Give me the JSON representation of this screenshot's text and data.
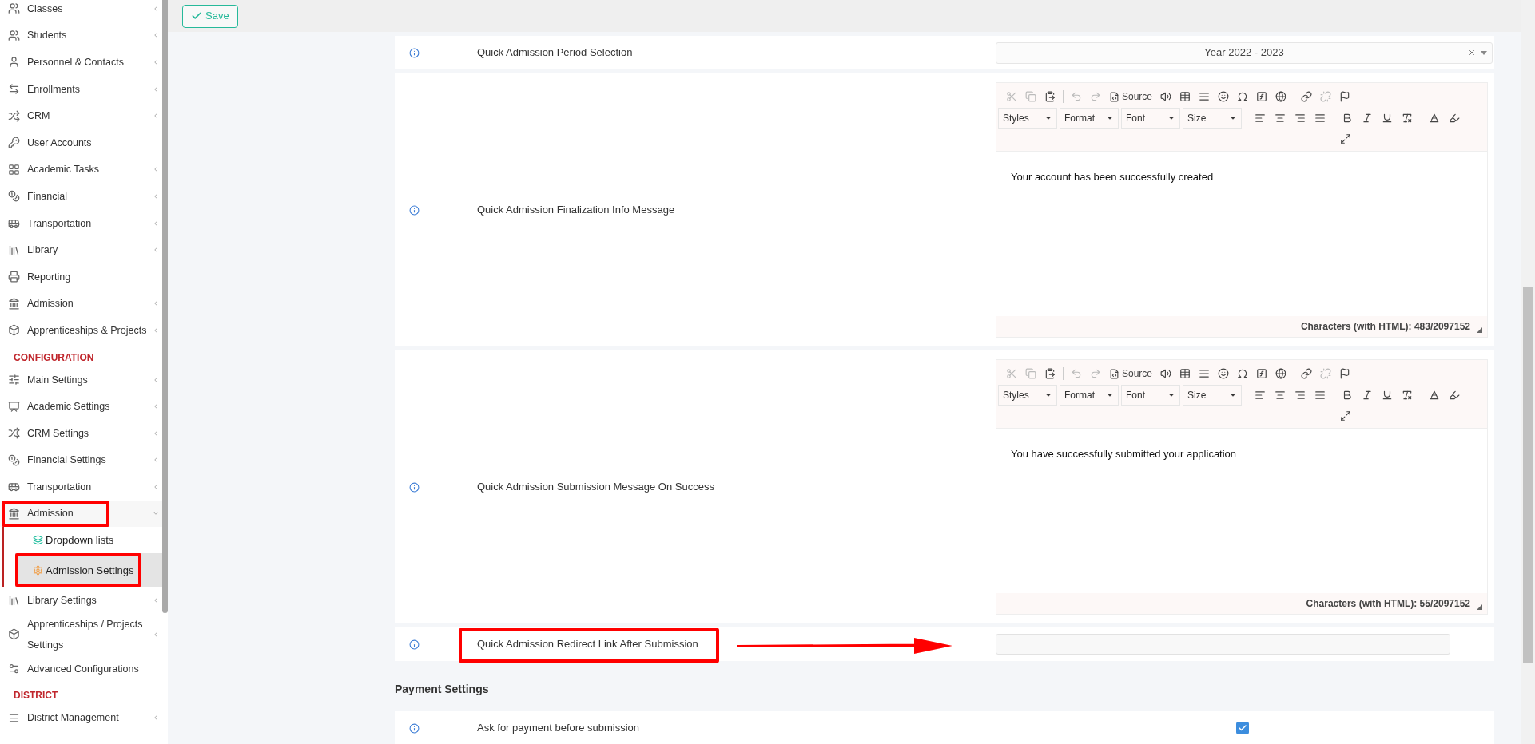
{
  "save_button": {
    "label": "Save"
  },
  "sidebar": {
    "sections": [
      {
        "items": [
          {
            "label": "Classes",
            "kind": "menu",
            "selected": false,
            "highlighted": false
          },
          {
            "label": "Students",
            "kind": "menu",
            "expanded": false,
            "selected": false,
            "highlighted": false
          },
          {
            "label": "Personnel & Contacts",
            "kind": "menu",
            "expanded": false,
            "selected": false,
            "highlighted": false
          },
          {
            "label": "Enrollments",
            "kind": "menu",
            "expanded": false,
            "selected": false,
            "highlighted": false
          },
          {
            "label": "CRM",
            "kind": "menu",
            "expanded": false,
            "selected": false,
            "highlighted": false
          },
          {
            "label": "User Accounts",
            "kind": "link",
            "selected": false,
            "highlighted": false
          },
          {
            "label": "Academic Tasks",
            "kind": "menu",
            "expanded": false,
            "selected": false,
            "highlighted": false
          },
          {
            "label": "Financial",
            "kind": "menu",
            "expanded": false,
            "selected": false,
            "highlighted": false
          },
          {
            "label": "Transportation",
            "kind": "menu",
            "expanded": false,
            "selected": false,
            "highlighted": false
          },
          {
            "label": "Library",
            "kind": "menu",
            "expanded": false,
            "selected": false,
            "highlighted": false
          },
          {
            "label": "Reporting",
            "kind": "link",
            "selected": false,
            "highlighted": false
          },
          {
            "label": "Admission",
            "kind": "menu",
            "expanded": false,
            "selected": false,
            "highlighted": false
          },
          {
            "label": "Apprenticeships & Projects",
            "kind": "menu",
            "expanded": false,
            "selected": false,
            "highlighted": false
          }
        ]
      },
      {
        "heading": "CONFIGURATION",
        "items": [
          {
            "label": "Main Settings",
            "kind": "menu",
            "expanded": false,
            "selected": false,
            "highlighted": false
          },
          {
            "label": "Academic Settings",
            "kind": "menu",
            "expanded": false,
            "selected": false,
            "highlighted": false
          },
          {
            "label": "CRM Settings",
            "kind": "menu",
            "expanded": false,
            "selected": false,
            "highlighted": false
          },
          {
            "label": "Financial Settings",
            "kind": "menu",
            "expanded": false,
            "selected": false,
            "highlighted": false
          },
          {
            "label": "Transportation",
            "kind": "menu",
            "expanded": false,
            "selected": false,
            "highlighted": false
          },
          {
            "label": "Admission",
            "kind": "menu",
            "expanded": true,
            "selected": false,
            "highlighted": true,
            "children": [
              {
                "label": "Dropdown lists",
                "selected": false,
                "highlighted": false
              },
              {
                "label": "Admission Settings",
                "selected": true,
                "highlighted": true
              }
            ]
          },
          {
            "label": "Library Settings",
            "kind": "menu",
            "expanded": false,
            "selected": false,
            "highlighted": false
          },
          {
            "label": "Apprenticeships / Projects Settings",
            "kind": "menu",
            "expanded": false,
            "selected": false,
            "highlighted": false
          },
          {
            "label": "Advanced Configurations",
            "kind": "link",
            "selected": false,
            "highlighted": false
          }
        ]
      },
      {
        "heading": "DISTRICT",
        "items": [
          {
            "label": "District Management",
            "kind": "menu",
            "expanded": false,
            "selected": false,
            "highlighted": false
          }
        ]
      }
    ]
  },
  "settings": [
    {
      "kind": "select",
      "label": "Quick Admission Period Selection",
      "value": "Year 2022 - 2023",
      "highlighted": false
    },
    {
      "kind": "editor",
      "label": "Quick Admission Finalization Info Message",
      "source": "Source",
      "combos": [
        "Styles",
        "Format",
        "Font",
        "Size"
      ],
      "content": "Your account has been successfully created",
      "counter": "Characters (with HTML): 483/2097152",
      "highlighted": false
    },
    {
      "kind": "editor",
      "label": "Quick Admission Submission Message On Success",
      "source": "Source",
      "combos": [
        "Styles",
        "Format",
        "Font",
        "Size"
      ],
      "content": "You have successfully submitted your application",
      "counter": "Characters (with HTML): 55/2097152",
      "highlighted": false
    },
    {
      "kind": "text",
      "label": "Quick Admission Redirect Link After Submission",
      "highlighted": true
    }
  ],
  "payment": {
    "heading": "Payment Settings",
    "settings": [
      {
        "kind": "checkbox",
        "label": "Ask for payment before submission",
        "checked": true
      }
    ]
  }
}
